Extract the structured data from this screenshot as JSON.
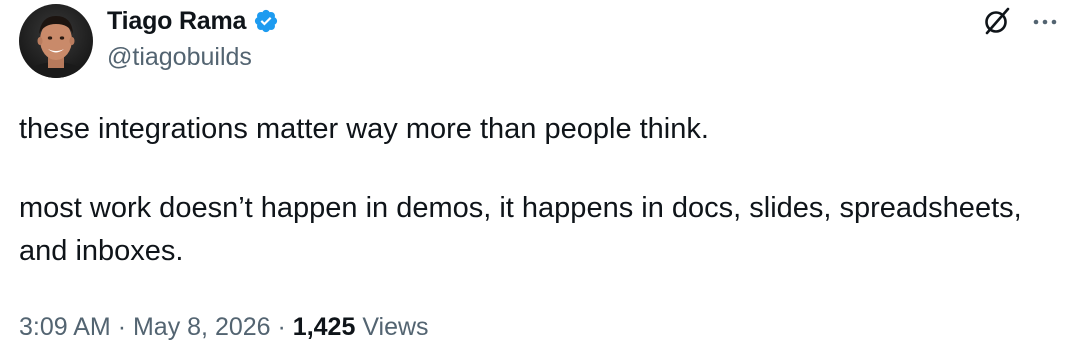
{
  "author": {
    "display_name": "Tiago Rama",
    "handle": "@tiagobuilds",
    "verified": true,
    "verified_color": "#1d9bf0"
  },
  "header_actions": {
    "grok_icon": "grok-icon",
    "more_icon": "more-options-icon"
  },
  "tweet": {
    "paragraph_1": "these integrations matter way more than people think.",
    "paragraph_2": "most work doesn’t happen in demos, it happens in docs, slides, spreadsheets, and inboxes."
  },
  "meta": {
    "time": "3:09 AM",
    "separator": "·",
    "date": "May 8, 2026",
    "views_count": "1,425",
    "views_label": "Views"
  }
}
